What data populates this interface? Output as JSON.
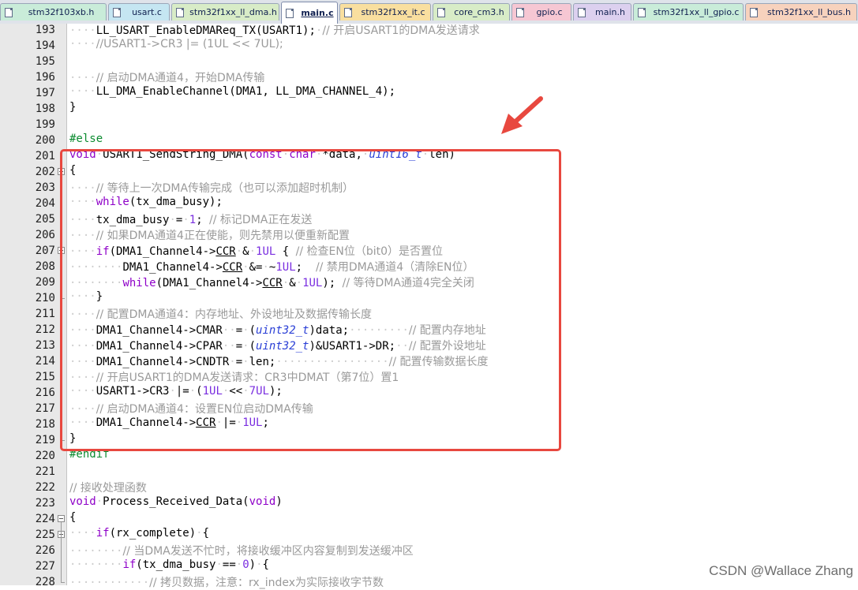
{
  "tabs": [
    {
      "label": "stm32f103xb.h",
      "color": "#c9ecd9"
    },
    {
      "label": "usart.c",
      "color": "#c5e6f2"
    },
    {
      "label": "stm32f1xx_ll_dma.h",
      "color": "#d8ecc7"
    },
    {
      "label": "main.c",
      "color": "#ffffff",
      "active": true
    },
    {
      "label": "stm32f1xx_it.c",
      "color": "#f9df9f"
    },
    {
      "label": "core_cm3.h",
      "color": "#d8ecc7"
    },
    {
      "label": "gpio.c",
      "color": "#f6c7d3"
    },
    {
      "label": "main.h",
      "color": "#dcd0ef"
    },
    {
      "label": "stm32f1xx_ll_gpio.c",
      "color": "#c9ecd9"
    },
    {
      "label": "stm32f1xx_ll_bus.h",
      "color": "#f7d2bd"
    }
  ],
  "code_lines": [
    {
      "num": "193",
      "tokens": [
        [
          "ws",
          "····"
        ],
        [
          "",
          "LL_USART_EnableDMAReq_TX(USART1);"
        ],
        [
          "ws",
          "·"
        ],
        [
          "cm",
          "// 开启USART1的DMA发送请求"
        ]
      ]
    },
    {
      "num": "194",
      "tokens": [
        [
          "ws",
          "····"
        ],
        [
          "cm",
          "//USART1->CR3 |= (1UL << 7UL);"
        ]
      ]
    },
    {
      "num": "195",
      "tokens": []
    },
    {
      "num": "196",
      "tokens": [
        [
          "ws",
          "····"
        ],
        [
          "cm",
          "// 启动DMA通道4，开始DMA传输"
        ]
      ]
    },
    {
      "num": "197",
      "tokens": [
        [
          "ws",
          "····"
        ],
        [
          "",
          "LL_DMA_EnableChannel(DMA1, LL_DMA_CHANNEL_4);"
        ]
      ]
    },
    {
      "num": "198",
      "tokens": [
        [
          "",
          "}"
        ]
      ]
    },
    {
      "num": "199",
      "tokens": []
    },
    {
      "num": "200",
      "tokens": [
        [
          "pp",
          "#else"
        ]
      ]
    },
    {
      "num": "201",
      "tokens": [
        [
          "kw",
          "void"
        ],
        [
          "ws",
          "·"
        ],
        [
          "",
          "USART1_SendString_DMA("
        ],
        [
          "kw",
          "const"
        ],
        [
          "ws",
          "·"
        ],
        [
          "kw",
          "char"
        ],
        [
          "ws",
          "·"
        ],
        [
          "",
          "*data,"
        ],
        [
          "ws",
          "·"
        ],
        [
          "ty",
          "uint16_t"
        ],
        [
          "ws",
          "·"
        ],
        [
          "",
          "len)"
        ]
      ]
    },
    {
      "num": "202",
      "tokens": [
        [
          "",
          "{"
        ]
      ]
    },
    {
      "num": "203",
      "tokens": [
        [
          "ws",
          "····"
        ],
        [
          "cm",
          "// 等待上一次DMA传输完成（也可以添加超时机制）"
        ]
      ]
    },
    {
      "num": "204",
      "tokens": [
        [
          "ws",
          "····"
        ],
        [
          "kw",
          "while"
        ],
        [
          "",
          "(tx_dma_busy);"
        ]
      ]
    },
    {
      "num": "205",
      "tokens": [
        [
          "ws",
          "····"
        ],
        [
          "",
          "tx_dma_busy"
        ],
        [
          "ws",
          "·"
        ],
        [
          "",
          "="
        ],
        [
          "ws",
          "·"
        ],
        [
          "nm",
          "1"
        ],
        [
          "",
          "; "
        ],
        [
          "cm",
          "// 标记DMA正在发送"
        ]
      ]
    },
    {
      "num": "206",
      "tokens": [
        [
          "ws",
          "····"
        ],
        [
          "cm",
          "// 如果DMA通道4正在使能，则先禁用以便重新配置"
        ]
      ]
    },
    {
      "num": "207",
      "tokens": [
        [
          "ws",
          "····"
        ],
        [
          "kw",
          "if"
        ],
        [
          "",
          "(DMA1_Channel4->"
        ],
        [
          "ul",
          "CCR"
        ],
        [
          "ws",
          "·"
        ],
        [
          "",
          "&"
        ],
        [
          "ws",
          "·"
        ],
        [
          "nm",
          "1UL"
        ],
        [
          "",
          " { "
        ],
        [
          "cm",
          "// 检查EN位（bit0）是否置位"
        ]
      ]
    },
    {
      "num": "208",
      "tokens": [
        [
          "ws",
          "········"
        ],
        [
          "",
          "DMA1_Channel4->"
        ],
        [
          "ul",
          "CCR"
        ],
        [
          "ws",
          "·"
        ],
        [
          "",
          "&="
        ],
        [
          "ws",
          "·"
        ],
        [
          "",
          "~"
        ],
        [
          "nm",
          "1UL"
        ],
        [
          "",
          ";  "
        ],
        [
          "cm",
          "// 禁用DMA通道4（清除EN位）"
        ]
      ]
    },
    {
      "num": "209",
      "tokens": [
        [
          "ws",
          "········"
        ],
        [
          "kw",
          "while"
        ],
        [
          "",
          "(DMA1_Channel4->"
        ],
        [
          "ul",
          "CCR"
        ],
        [
          "ws",
          "·"
        ],
        [
          "",
          "&"
        ],
        [
          "ws",
          "·"
        ],
        [
          "nm",
          "1UL"
        ],
        [
          "",
          "); "
        ],
        [
          "cm",
          "// 等待DMA通道4完全关闭"
        ]
      ]
    },
    {
      "num": "210",
      "tokens": [
        [
          "ws",
          "····"
        ],
        [
          "",
          "}"
        ]
      ]
    },
    {
      "num": "211",
      "tokens": [
        [
          "ws",
          "····"
        ],
        [
          "cm",
          "// 配置DMA通道4：内存地址、外设地址及数据传输长度"
        ]
      ]
    },
    {
      "num": "212",
      "tokens": [
        [
          "ws",
          "····"
        ],
        [
          "",
          "DMA1_Channel4->CMAR"
        ],
        [
          "ws",
          "··"
        ],
        [
          "",
          "="
        ],
        [
          "ws",
          "·"
        ],
        [
          "",
          "("
        ],
        [
          "ty",
          "uint32_t"
        ],
        [
          "",
          ")data;"
        ],
        [
          "ws",
          "·········"
        ],
        [
          "cm",
          "// 配置内存地址"
        ]
      ]
    },
    {
      "num": "213",
      "tokens": [
        [
          "ws",
          "····"
        ],
        [
          "",
          "DMA1_Channel4->CPAR"
        ],
        [
          "ws",
          "··"
        ],
        [
          "",
          "="
        ],
        [
          "ws",
          "·"
        ],
        [
          "",
          "("
        ],
        [
          "ty",
          "uint32_t"
        ],
        [
          "",
          ")&USART1->DR;"
        ],
        [
          "ws",
          "··"
        ],
        [
          "cm",
          "// 配置外设地址"
        ]
      ]
    },
    {
      "num": "214",
      "tokens": [
        [
          "ws",
          "····"
        ],
        [
          "",
          "DMA1_Channel4->CNDTR"
        ],
        [
          "ws",
          "·"
        ],
        [
          "",
          "="
        ],
        [
          "ws",
          "·"
        ],
        [
          "",
          "len;"
        ],
        [
          "ws",
          "·················"
        ],
        [
          "cm",
          "// 配置传输数据长度"
        ]
      ]
    },
    {
      "num": "215",
      "tokens": [
        [
          "ws",
          "····"
        ],
        [
          "cm",
          "// 开启USART1的DMA发送请求：CR3中DMAT（第7位）置1"
        ]
      ]
    },
    {
      "num": "216",
      "tokens": [
        [
          "ws",
          "····"
        ],
        [
          "",
          "USART1->CR3"
        ],
        [
          "ws",
          "·"
        ],
        [
          "",
          "|="
        ],
        [
          "ws",
          "·"
        ],
        [
          "",
          "("
        ],
        [
          "nm",
          "1UL"
        ],
        [
          "ws",
          "·"
        ],
        [
          "",
          "<<"
        ],
        [
          "ws",
          "·"
        ],
        [
          "nm",
          "7UL"
        ],
        [
          "",
          ");"
        ]
      ]
    },
    {
      "num": "217",
      "tokens": [
        [
          "ws",
          "····"
        ],
        [
          "cm",
          "// 启动DMA通道4：设置EN位启动DMA传输"
        ]
      ]
    },
    {
      "num": "218",
      "tokens": [
        [
          "ws",
          "····"
        ],
        [
          "",
          "DMA1_Channel4->"
        ],
        [
          "ul",
          "CCR"
        ],
        [
          "ws",
          "·"
        ],
        [
          "",
          "|="
        ],
        [
          "ws",
          "·"
        ],
        [
          "nm",
          "1UL"
        ],
        [
          "",
          ";"
        ]
      ]
    },
    {
      "num": "219",
      "tokens": [
        [
          "",
          "}"
        ]
      ]
    },
    {
      "num": "220",
      "tokens": [
        [
          "pp",
          "#endif"
        ]
      ]
    },
    {
      "num": "221",
      "tokens": []
    },
    {
      "num": "222",
      "tokens": [
        [
          "cm",
          "// 接收处理函数"
        ]
      ]
    },
    {
      "num": "223",
      "tokens": [
        [
          "kw",
          "void"
        ],
        [
          "ws",
          "·"
        ],
        [
          "",
          "Process_Received_Data("
        ],
        [
          "kw",
          "void"
        ],
        [
          "",
          ")"
        ]
      ]
    },
    {
      "num": "224",
      "tokens": [
        [
          "",
          "{"
        ]
      ]
    },
    {
      "num": "225",
      "tokens": [
        [
          "ws",
          "····"
        ],
        [
          "kw",
          "if"
        ],
        [
          "",
          "(rx_complete)"
        ],
        [
          "ws",
          "·"
        ],
        [
          "",
          "{"
        ]
      ]
    },
    {
      "num": "226",
      "tokens": [
        [
          "ws",
          "········"
        ],
        [
          "cm",
          "// 当DMA发送不忙时，将接收缓冲区内容复制到发送缓冲区"
        ]
      ]
    },
    {
      "num": "227",
      "tokens": [
        [
          "ws",
          "········"
        ],
        [
          "kw",
          "if"
        ],
        [
          "",
          "(tx_dma_busy"
        ],
        [
          "ws",
          "·"
        ],
        [
          "",
          "=="
        ],
        [
          "ws",
          "·"
        ],
        [
          "nm",
          "0"
        ],
        [
          "",
          ")"
        ],
        [
          "ws",
          "·"
        ],
        [
          "",
          "{"
        ]
      ]
    },
    {
      "num": "228",
      "tokens": [
        [
          "ws",
          "············"
        ],
        [
          "cm",
          "// 拷贝数据，注意：rx_index为实际接收字节数"
        ]
      ]
    }
  ],
  "watermark": "CSDN @Wallace Zhang",
  "colors": {
    "highlight": "#e8483f",
    "keyword": "#8e00c8",
    "type": "#2a3fd6",
    "comment": "#9a9a9a",
    "preprocessor": "#0b8b2f"
  }
}
